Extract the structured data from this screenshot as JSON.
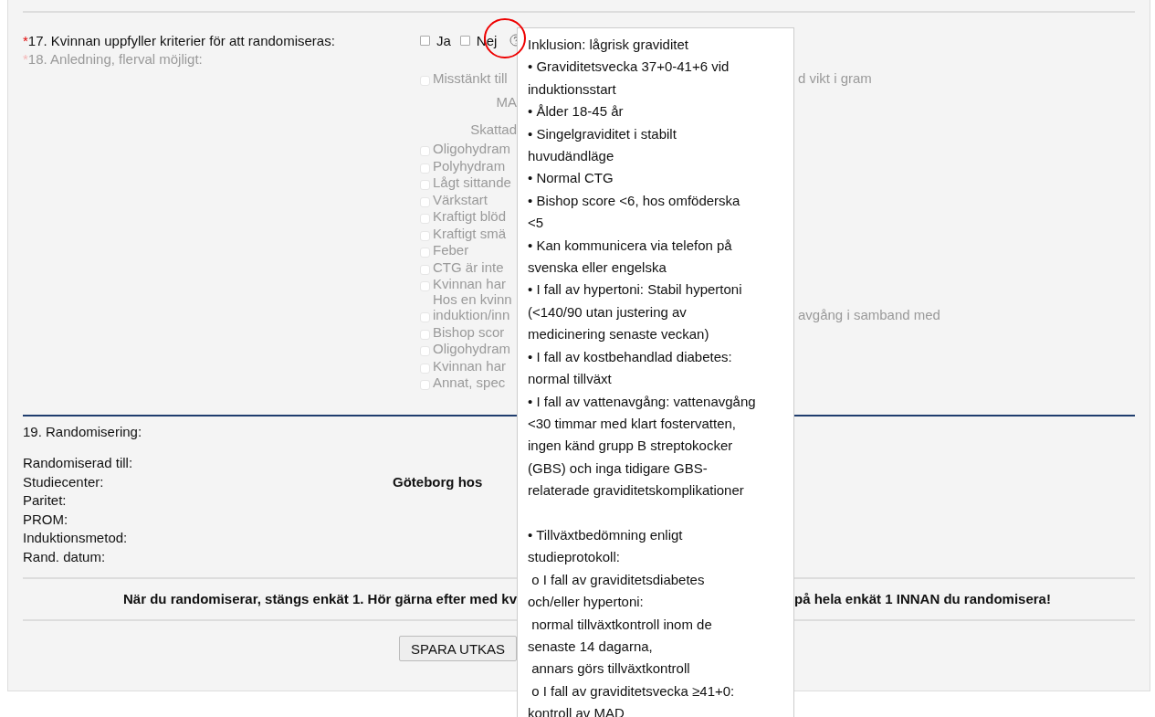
{
  "q17": {
    "marker": "*",
    "label": "17. Kvinnan uppfyller kriterier för att randomiseras:",
    "options": [
      {
        "label": "Ja",
        "checked": false
      },
      {
        "label": "Nej",
        "checked": false
      }
    ]
  },
  "q18": {
    "marker": "*",
    "label": "18. Anledning, flerval möjligt:",
    "disabled": true,
    "items": [
      {
        "kind": "checkbox",
        "checked": false,
        "lines": [
          "Misstänkt till"
        ],
        "tail": "d vikt i gram"
      },
      {
        "kind": "text",
        "lines": [
          "MA"
        ]
      },
      {
        "kind": "text",
        "lines": [
          "Skattad"
        ]
      },
      {
        "kind": "checkbox",
        "checked": false,
        "lines": [
          "Oligohydram"
        ]
      },
      {
        "kind": "checkbox",
        "checked": false,
        "lines": [
          "Polyhydram"
        ]
      },
      {
        "kind": "checkbox",
        "checked": false,
        "lines": [
          "Lågt sittande"
        ]
      },
      {
        "kind": "checkbox",
        "checked": false,
        "lines": [
          "Värkstart"
        ]
      },
      {
        "kind": "checkbox",
        "checked": false,
        "lines": [
          "Kraftigt blöd"
        ]
      },
      {
        "kind": "checkbox",
        "checked": false,
        "lines": [
          "Kraftigt smä"
        ]
      },
      {
        "kind": "checkbox",
        "checked": false,
        "lines": [
          "Feber"
        ]
      },
      {
        "kind": "checkbox",
        "checked": false,
        "lines": [
          "CTG är inte"
        ]
      },
      {
        "kind": "checkbox",
        "checked": false,
        "lines": [
          "Kvinnan har"
        ]
      },
      {
        "kind": "checkbox",
        "checked": false,
        "lines": [
          "Hos en kvinn",
          "induktion/inn"
        ],
        "tail": "avgång i samband med"
      },
      {
        "kind": "checkbox",
        "checked": false,
        "lines": [
          "Bishop scor"
        ]
      },
      {
        "kind": "checkbox",
        "checked": false,
        "lines": [
          "Oligohydram"
        ]
      },
      {
        "kind": "checkbox",
        "checked": false,
        "lines": [
          "Kvinnan har"
        ]
      },
      {
        "kind": "checkbox",
        "checked": false,
        "lines": [
          "Annat, spec"
        ]
      }
    ]
  },
  "q19": {
    "label": "19. Randomisering:",
    "fields": [
      {
        "label": "Randomiserad till:"
      },
      {
        "label": "Studiecenter:",
        "value": "Göteborg hos"
      },
      {
        "label": "Paritet:"
      },
      {
        "label": "PROM:"
      },
      {
        "label": "Induktionsmetod:"
      },
      {
        "label": "Rand. datum:"
      }
    ]
  },
  "notice": {
    "left": "När du randomiserar, stängs enkät 1. Hör gärna efter med kv",
    "right": "på hela enkät 1 INNAN du randomisera!"
  },
  "buttons": [
    "SPARA UTKAS"
  ],
  "tooltip": {
    "blocks": [
      {
        "lines": [
          "Inklusion: lågrisk graviditet",
          "• Graviditetsvecka 37+0-41+6 vid",
          "induktionsstart",
          "• Ålder 18-45 år",
          "• Singelgraviditet i stabilt",
          "huvudändläge",
          "• Normal CTG",
          "• Bishop score <6, hos omföderska",
          "<5",
          "• Kan kommunicera via telefon på",
          "svenska eller engelska",
          "• I fall av hypertoni: Stabil hypertoni",
          "(<140/90 utan justering av",
          "medicinering senaste veckan)",
          "• I fall av kostbehandlad diabetes:",
          "normal tillväxt",
          "• I fall av vattenavgång: vattenavgång",
          "<30 timmar med klart fostervatten,",
          "ingen känd grupp B streptokocker",
          "(GBS) och inga tidigare GBS-",
          "relaterade graviditetskomplikationer"
        ]
      },
      {
        "lines": [
          "• Tillväxtbedömning enligt",
          "studieprotokoll:",
          " o I fall av graviditetsdiabetes",
          "och/eller hypertoni:",
          " normal tillväxtkontroll inom de",
          "senaste 14 dagarna,",
          " annars görs tillväxtkontroll",
          " o I fall av graviditetsvecka ≥41+0:",
          "kontroll av MAD"
        ]
      }
    ]
  }
}
